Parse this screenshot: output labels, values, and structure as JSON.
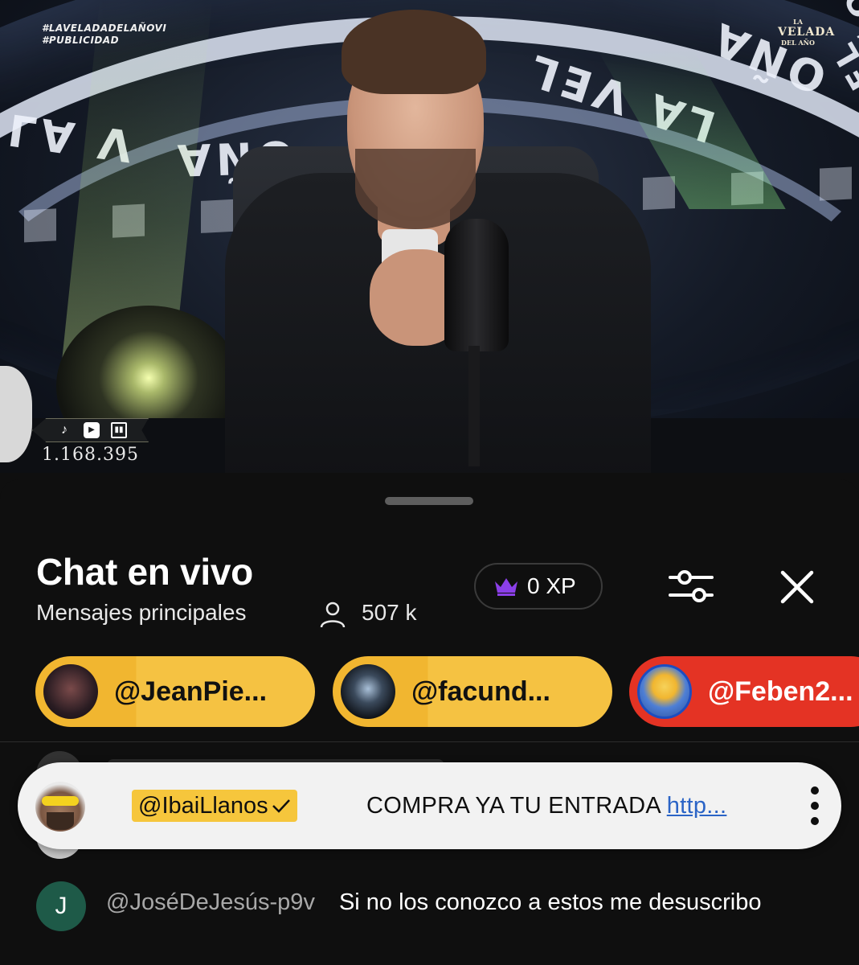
{
  "video": {
    "hashtag_line1": "#LAVELADADELAÑOVI",
    "hashtag_line2": "#PUBLICIDAD",
    "logo_line1": "LA",
    "logo_line2": "VELADA",
    "logo_line3": "DEL AÑO",
    "ring_text": [
      "LA V",
      "OÑA",
      "LA VEL",
      "OÑA",
      "EL AÑO"
    ],
    "viewer_count": "1.168.395",
    "platform_icons": [
      "tiktok-icon",
      "youtube-icon",
      "twitch-icon"
    ]
  },
  "chat": {
    "title": "Chat en vivo",
    "mode": "Mensajes principales",
    "viewers": "507 k",
    "xp": "0 XP",
    "pinned_users": [
      {
        "name": "@JeanPie...",
        "color": "#f5c242"
      },
      {
        "name": "@facund...",
        "color": "#f5c242"
      },
      {
        "name": "@Feben2...",
        "color": "#e43324"
      }
    ],
    "pinned_message": {
      "author": "@IbaiLlanos",
      "text": "COMPRA YA TU ENTRADA ",
      "link": "http..."
    },
    "messages": [
      {
        "initial": "J",
        "author": "@JoséDeJesús-p9v",
        "text": "Si no los conozco a estos me desuscribo"
      }
    ]
  }
}
